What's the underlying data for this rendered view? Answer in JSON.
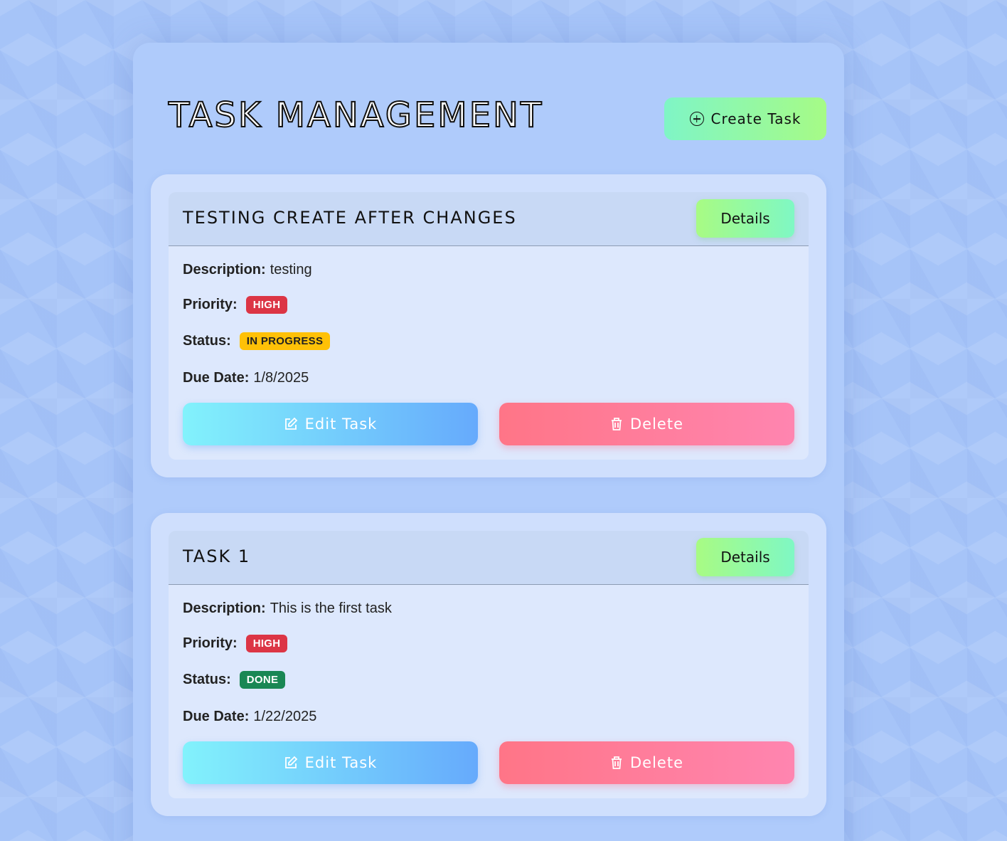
{
  "header": {
    "title": "Task Management",
    "create_label": "Create Task"
  },
  "tasks": [
    {
      "title": "Testing create after changes",
      "details_label": "Details",
      "description_label": "Description:",
      "description": "testing",
      "priority_label": "Priority:",
      "priority": "HIGH",
      "status_label": "Status:",
      "status": "IN PROGRESS",
      "due_label": "Due Date:",
      "due_date": "1/8/2025",
      "edit_label": "Edit Task",
      "delete_label": "Delete"
    },
    {
      "title": "Task 1",
      "details_label": "Details",
      "description_label": "Description:",
      "description": "This is the first task",
      "priority_label": "Priority:",
      "priority": "HIGH",
      "status_label": "Status:",
      "status": "DONE",
      "due_label": "Due Date:",
      "due_date": "1/22/2025",
      "edit_label": "Edit Task",
      "delete_label": "Delete"
    }
  ],
  "colors": {
    "priority_high": "#dc3545",
    "status_in_progress": "#ffc107",
    "status_done": "#198754"
  }
}
